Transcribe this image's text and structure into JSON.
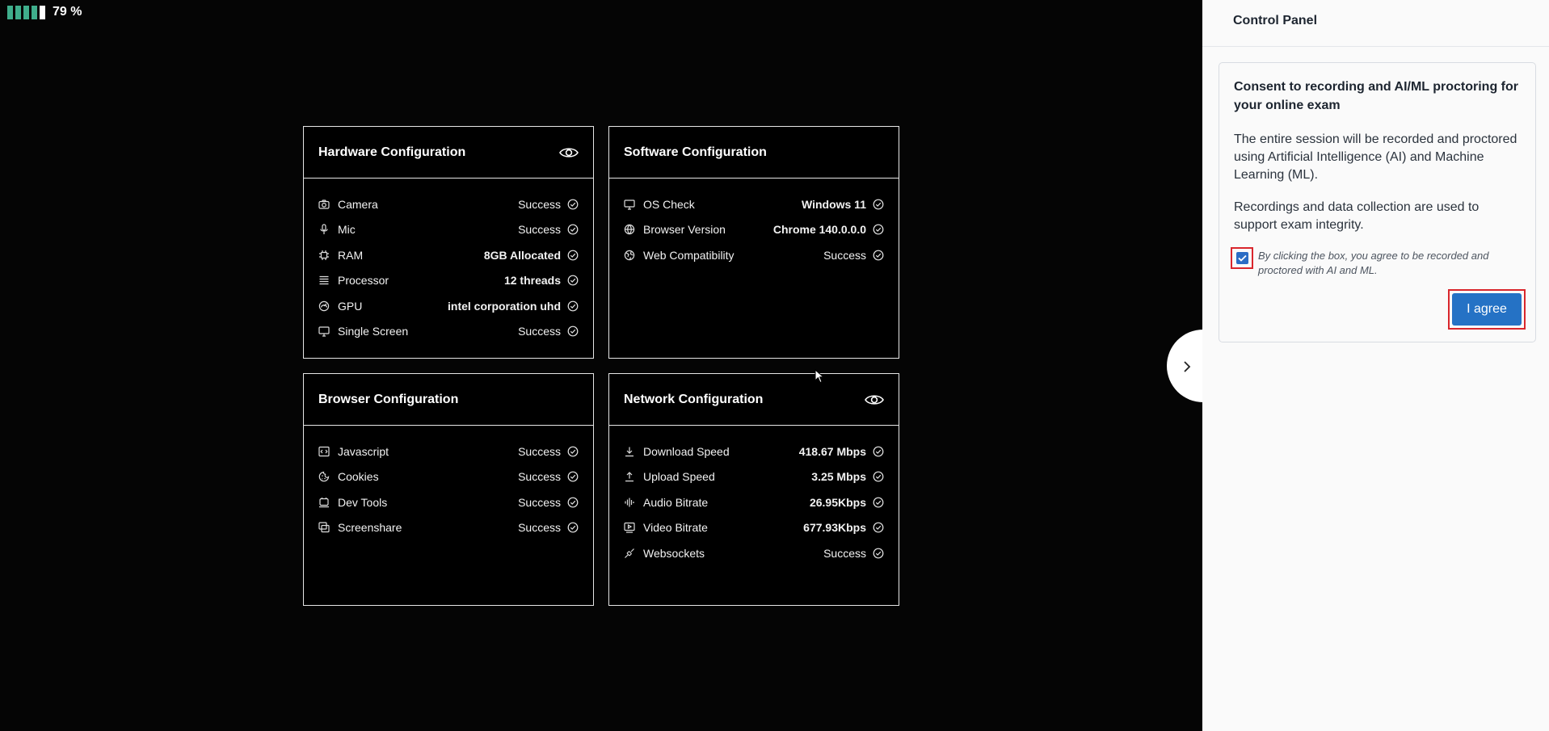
{
  "battery": {
    "percent_label": "79 %",
    "filled_segments": 4,
    "total_segments": 5,
    "color": "#3fae8c"
  },
  "cards": {
    "hardware": {
      "title": "Hardware Configuration",
      "rows": [
        {
          "icon": "camera-icon",
          "label": "Camera",
          "value": "Success"
        },
        {
          "icon": "mic-icon",
          "label": "Mic",
          "value": "Success"
        },
        {
          "icon": "chip-icon",
          "label": "RAM",
          "value": "8GB Allocated"
        },
        {
          "icon": "processor-icon",
          "label": "Processor",
          "value": "12 threads"
        },
        {
          "icon": "gpu-icon",
          "label": "GPU",
          "value": "intel corporation uhd"
        },
        {
          "icon": "monitor-icon",
          "label": "Single Screen",
          "value": "Success"
        }
      ]
    },
    "software": {
      "title": "Software Configuration",
      "rows": [
        {
          "icon": "monitor-icon",
          "label": "OS Check",
          "value": "Windows 11"
        },
        {
          "icon": "globe-icon",
          "label": "Browser Version",
          "value": "Chrome 140.0.0.0"
        },
        {
          "icon": "web-icon",
          "label": "Web Compatibility",
          "value": "Success"
        }
      ]
    },
    "browser": {
      "title": "Browser Configuration",
      "rows": [
        {
          "icon": "code-icon",
          "label": "Javascript",
          "value": "Success"
        },
        {
          "icon": "cookie-icon",
          "label": "Cookies",
          "value": "Success"
        },
        {
          "icon": "devtools-icon",
          "label": "Dev Tools",
          "value": "Success"
        },
        {
          "icon": "screenshare-icon",
          "label": "Screenshare",
          "value": "Success"
        }
      ]
    },
    "network": {
      "title": "Network Configuration",
      "rows": [
        {
          "icon": "download-icon",
          "label": "Download Speed",
          "value": "418.67 Mbps"
        },
        {
          "icon": "upload-icon",
          "label": "Upload Speed",
          "value": "3.25 Mbps"
        },
        {
          "icon": "audio-icon",
          "label": "Audio Bitrate",
          "value": "26.95Kbps"
        },
        {
          "icon": "video-icon",
          "label": "Video Bitrate",
          "value": "677.93Kbps"
        },
        {
          "icon": "plug-icon",
          "label": "Websockets",
          "value": "Success"
        }
      ]
    }
  },
  "panel": {
    "title": "Control Panel",
    "consent_title": "Consent to recording and AI/ML proctoring for your online exam",
    "paragraph1": "The entire session will be recorded and proctored using Artificial Intelligence (AI) and Machine Learning (ML).",
    "paragraph2": "Recordings and data collection are used to support exam integrity.",
    "checkbox_text": "By clicking the box, you agree to be recorded and proctored with AI and ML.",
    "checkbox_checked": true,
    "agree_button": "I agree",
    "accent_color": "#2572c5",
    "highlight_color": "#d9262c"
  }
}
